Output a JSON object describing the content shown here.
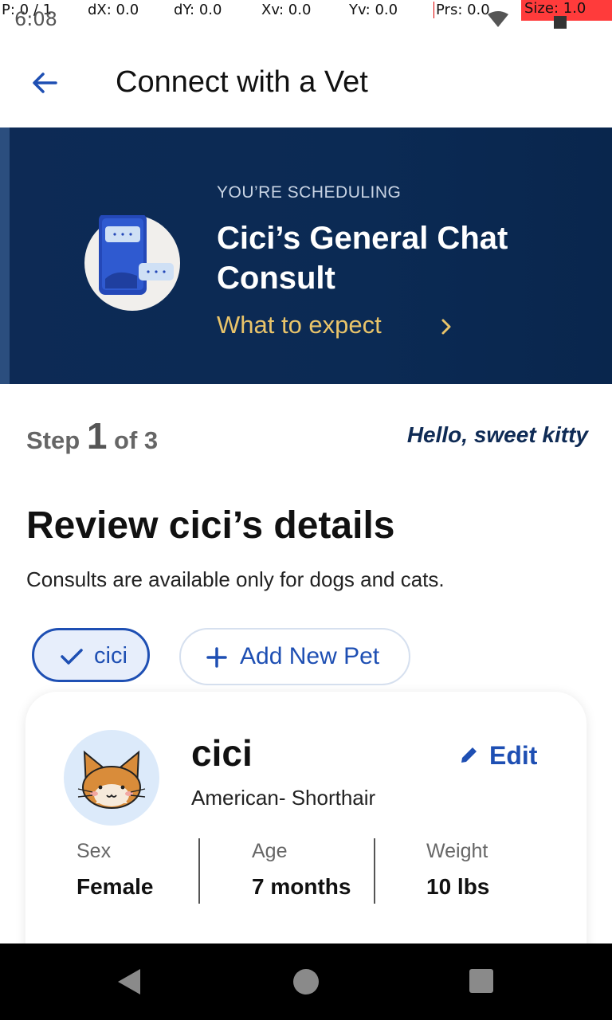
{
  "debug": {
    "p": "P: 0 / 1",
    "clock": "6:08",
    "dx": "dX: 0.0",
    "dy": "dY: 0.0",
    "xv": "Xv: 0.0",
    "yv": "Yv: 0.0",
    "prs": "Prs: 0.0",
    "size": "Size: 1.0"
  },
  "appbar": {
    "title": "Connect with a Vet"
  },
  "banner": {
    "kicker": "YOU’RE SCHEDULING",
    "title": "Cici’s General Chat Consult",
    "link": "What to expect"
  },
  "step": {
    "prefix": "Step",
    "current": "1",
    "suffix": "of 3",
    "greeting": "Hello, sweet kitty"
  },
  "section": {
    "title": "Review cici’s details",
    "subtitle": "Consults are available only for dogs and cats."
  },
  "chips": {
    "selected": "cici",
    "add": "Add New Pet"
  },
  "pet": {
    "name": "cici",
    "breed": "American- Shorthair",
    "edit": "Edit",
    "stats": [
      {
        "label": "Sex",
        "value": "Female"
      },
      {
        "label": "Age",
        "value": "7 months"
      },
      {
        "label": "Weight",
        "value": "10 lbs"
      }
    ]
  },
  "colors": {
    "accent": "#1e4fb3",
    "banner": "#0d2a55",
    "link": "#e9c46a"
  },
  "icons": [
    "back-arrow-icon",
    "chevron-right-icon",
    "check-icon",
    "plus-icon",
    "pencil-icon",
    "cat-avatar-icon",
    "phone-chat-illustration"
  ]
}
